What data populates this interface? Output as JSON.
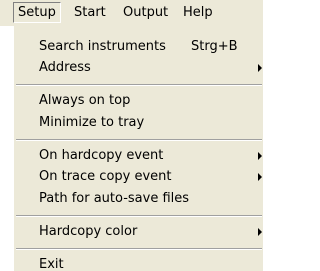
{
  "menubar": {
    "items": [
      {
        "label": "Setup"
      },
      {
        "label": "Start"
      },
      {
        "label": "Output"
      },
      {
        "label": "Help"
      }
    ]
  },
  "setup_menu": {
    "search_instruments": {
      "label": "Search instruments",
      "shortcut": "Strg+B"
    },
    "address": {
      "label": "Address"
    },
    "always_on_top": {
      "label": "Always on top"
    },
    "minimize_to_tray": {
      "label": "Minimize to tray"
    },
    "on_hardcopy_event": {
      "label": "On hardcopy event"
    },
    "on_trace_copy_event": {
      "label": "On trace copy event"
    },
    "path_auto_save": {
      "label": "Path for auto-save files"
    },
    "hardcopy_color": {
      "label": "Hardcopy color"
    },
    "exit": {
      "label": "Exit"
    }
  },
  "icons": {
    "submenu_arrow": "triangle-right"
  }
}
